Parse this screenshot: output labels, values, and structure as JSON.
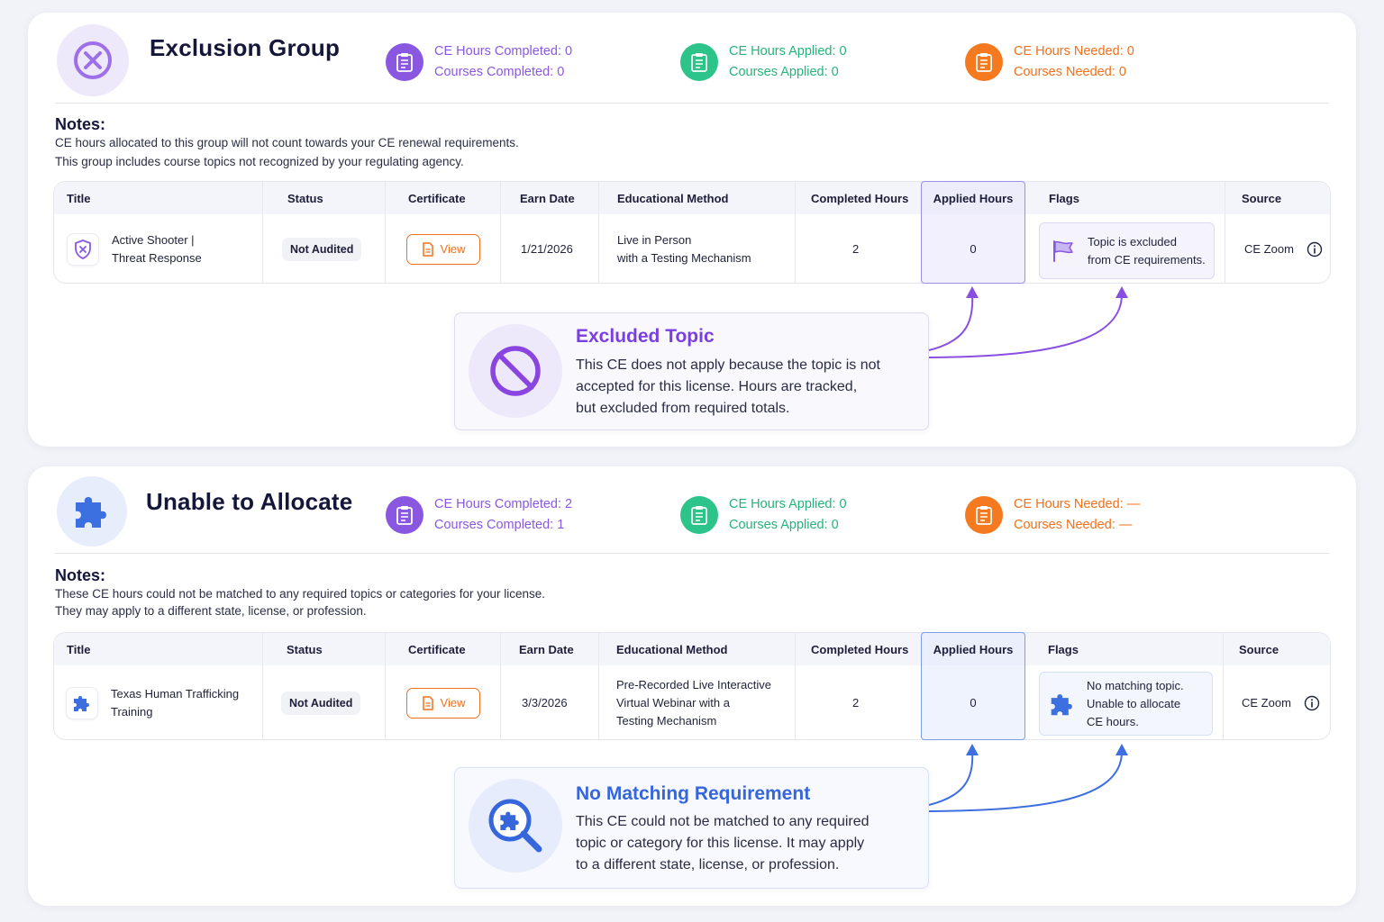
{
  "groups": [
    {
      "title": "Exclusion Group",
      "stats": {
        "completed_hours": "CE Hours Completed: 0",
        "completed_courses": "Courses Completed: 0",
        "applied_hours": "CE Hours Applied: 0",
        "applied_courses": "Courses Applied: 0",
        "needed_hours": "CE Hours Needed: 0",
        "needed_courses": "Courses Needed: 0"
      },
      "notes_title": "Notes:",
      "notes": [
        "CE hours allocated to this group will not count towards your CE renewal requirements.",
        "This group includes course topics not recognized by your regulating agency."
      ],
      "columns": [
        "Title",
        "Status",
        "Certificate",
        "Earn Date",
        "Educational Method",
        "Completed Hours",
        "Applied Hours",
        "Flags",
        "Source"
      ],
      "row": {
        "title_lines": [
          "Active Shooter |",
          "Threat Response"
        ],
        "status": "Not Audited",
        "certificate": "View",
        "earn_date": "1/21/2026",
        "method_lines": [
          "Live in Person",
          "with a Testing Mechanism"
        ],
        "completed_hours": "2",
        "applied_hours": "0",
        "flag_lines": [
          "Topic is excluded",
          "from CE requirements."
        ],
        "source": "CE Zoom"
      },
      "callout": {
        "title": "Excluded Topic",
        "body_lines": [
          "This CE does not apply because the topic is not",
          "accepted for this license. Hours are tracked,",
          "but excluded from required totals."
        ]
      }
    },
    {
      "title": "Unable to Allocate",
      "stats": {
        "completed_hours": "CE Hours Completed: 2",
        "completed_courses": "Courses Completed: 1",
        "applied_hours": "CE Hours Applied: 0",
        "applied_courses": "Courses Applied: 0",
        "needed_hours": "CE Hours Needed: —",
        "needed_courses": "Courses Needed: —"
      },
      "notes_title": "Notes:",
      "notes": [
        "These CE hours could not be matched to any required topics or categories for your license.",
        "They may apply to a different state, license, or profession."
      ],
      "columns": [
        "Title",
        "Status",
        "Certificate",
        "Earn Date",
        "Educational Method",
        "Completed Hours",
        "Applied Hours",
        "Flags",
        "Source"
      ],
      "row": {
        "title_lines": [
          "Texas Human Trafficking",
          "Training"
        ],
        "status": "Not Audited",
        "certificate": "View",
        "earn_date": "3/3/2026",
        "method_lines": [
          "Pre-Recorded Live Interactive",
          "Virtual Webinar with a",
          "Testing Mechanism"
        ],
        "completed_hours": "2",
        "applied_hours": "0",
        "flag_lines": [
          "No matching topic.",
          "Unable to allocate",
          "CE hours."
        ],
        "source": "CE Zoom"
      },
      "callout": {
        "title": "No Matching Requirement",
        "body_lines": [
          "This CE could not be matched to any required",
          "topic or category for this license. It may apply",
          "to a different state, license, or profession."
        ]
      }
    }
  ],
  "icons": {
    "group1_hero": "circle-x-icon",
    "group2_hero": "puzzle-piece-icon",
    "stat": "clipboard-icon",
    "row1_title": "shield-x-icon",
    "row2_title": "puzzle-piece-icon",
    "certificate": "document-icon",
    "flag1": "flag-icon",
    "flag2": "puzzle-piece-icon",
    "source_info": "info-icon",
    "callout1": "prohibited-icon",
    "callout2": "magnifier-puzzle-icon"
  },
  "colors": {
    "purple": "#8a58e0",
    "green": "#2cc48a",
    "orange": "#f57a1f",
    "blue": "#3c6fe0",
    "callout1_title": "#7b3fe0",
    "callout2_title": "#3666dc"
  }
}
